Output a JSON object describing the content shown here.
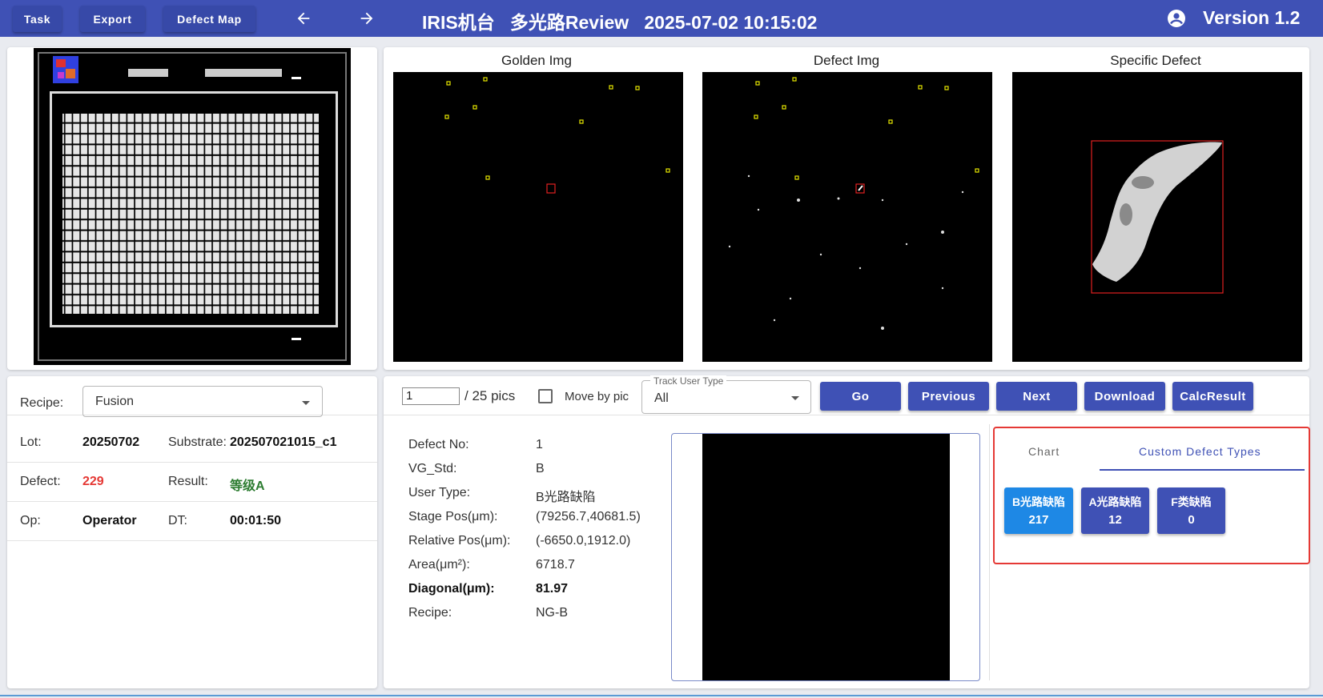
{
  "topbar": {
    "task_label": "Task",
    "export_label": "Export",
    "defect_map_label": "Defect Map",
    "title": "IRIS机台   多光路Review   2025-07-02 10:15:02",
    "version": "Version 1.2"
  },
  "images": {
    "golden_title": "Golden Img",
    "defect_title": "Defect Img",
    "specific_title": "Specific Defect"
  },
  "info": {
    "recipe_label": "Recipe:",
    "recipe_value": "Fusion",
    "lot_label": "Lot:",
    "lot_value": "20250702",
    "substrate_label": "Substrate:",
    "substrate_value": "202507021015_c1",
    "defect_label": "Defect:",
    "defect_value": "229",
    "result_label": "Result:",
    "result_value": "等级A",
    "op_label": "Op:",
    "op_value": "Operator",
    "dt_label": "DT:",
    "dt_value": "00:01:50"
  },
  "controls": {
    "page_value": "1",
    "page_total": "/ 25 pics",
    "move_by_pic_label": "Move by pic",
    "move_by_pic_checked": false,
    "track_user_type_label": "Track User Type",
    "track_user_type_value": "All",
    "go_label": "Go",
    "previous_label": "Previous",
    "next_label": "Next",
    "download_label": "Download",
    "calc_result_label": "CalcResult"
  },
  "details": {
    "defect_no_label": "Defect No:",
    "defect_no_value": "1",
    "vg_std_label": "VG_Std:",
    "vg_std_value": "B",
    "user_type_label": "User Type:",
    "user_type_value": "B光路缺陷",
    "stage_pos_label": "Stage Pos(μm):",
    "stage_pos_value": "(79256.7,40681.5)",
    "relative_pos_label": "Relative Pos(μm):",
    "relative_pos_value": "(-6650.0,1912.0)",
    "area_label": "Area(μm²):",
    "area_value": "6718.7",
    "diagonal_label": "Diagonal(μm):",
    "diagonal_value": "81.97",
    "recipe_label": "Recipe:",
    "recipe_value": "NG-B"
  },
  "defect_types": {
    "tab_chart": "Chart",
    "tab_custom": "Custom Defect Types",
    "active_tab": "Custom Defect Types",
    "chips": [
      {
        "name": "B光路缺陷",
        "count": "217",
        "color": "#1e88e5"
      },
      {
        "name": "A光路缺陷",
        "count": "12",
        "color": "#3f51b5"
      },
      {
        "name": "F类缺陷",
        "count": "0",
        "color": "#3f51b5"
      }
    ]
  },
  "colors": {
    "primary": "#3f51b5",
    "active_chip": "#1e88e5",
    "defect_count": "#e53935",
    "result_ok": "#2e7d32",
    "highlight_border": "#e53935"
  }
}
